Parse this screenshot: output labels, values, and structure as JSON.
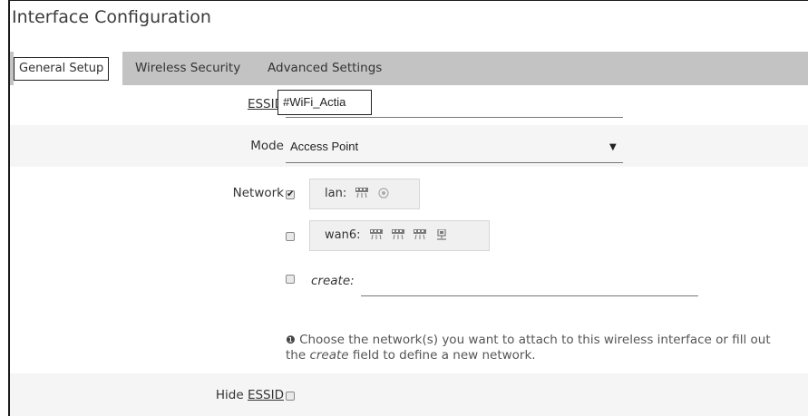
{
  "page": {
    "title": "Interface Configuration"
  },
  "tabs": [
    {
      "label": "General Setup",
      "active": true
    },
    {
      "label": "Wireless Security",
      "active": false
    },
    {
      "label": "Advanced Settings",
      "active": false
    }
  ],
  "essid": {
    "label": "ESSID",
    "value": "#WiFi_Actia"
  },
  "mode": {
    "label": "Mode",
    "value": "Access Point"
  },
  "network": {
    "label": "Network",
    "options": [
      {
        "name": "lan:",
        "checked": true,
        "icons": [
          "ethernet-switch-icon",
          "wifi-disabled-icon"
        ]
      },
      {
        "name": "wan6:",
        "checked": false,
        "icons": [
          "ethernet-switch-icon",
          "ethernet-switch-icon",
          "ethernet-switch-icon",
          "ethernet-port-icon"
        ]
      }
    ],
    "create_label": "create:",
    "create_checked": false,
    "help_prefix": "Choose the network(s) you want to attach to this wireless interface or fill out the ",
    "help_em": "create",
    "help_suffix": " field to define a new network."
  },
  "hide_essid": {
    "label_prefix": "Hide ",
    "label_link": "ESSID",
    "checked": false
  },
  "colors": {
    "tabbar": "#c3c3c3",
    "alt_row": "#f5f5f5",
    "netbox": "#f0f0f0"
  }
}
